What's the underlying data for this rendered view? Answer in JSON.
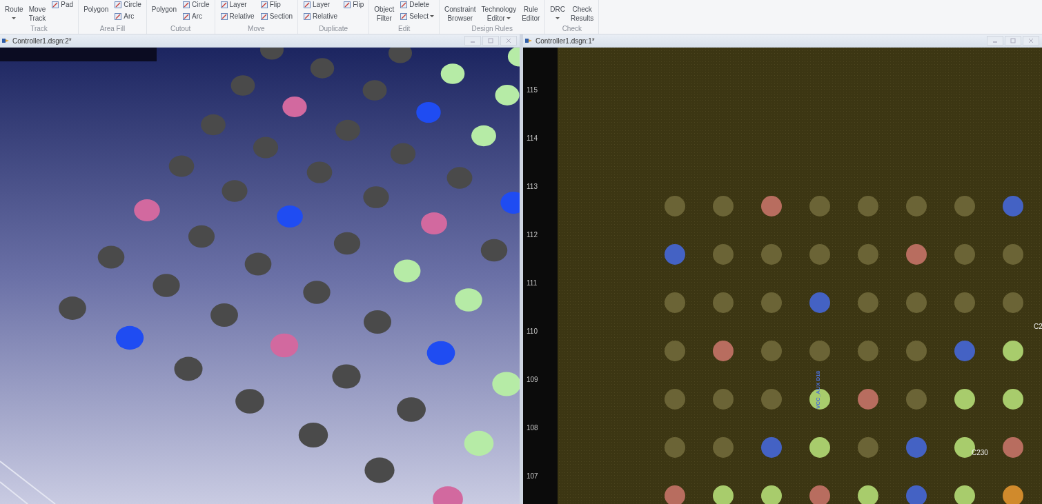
{
  "ribbon": {
    "groups": [
      {
        "label": "Track",
        "items": [
          {
            "kind": "large",
            "lines": [
              "Route"
            ],
            "dropdown": true
          },
          {
            "kind": "large",
            "lines": [
              "Move",
              "Track"
            ],
            "dropdown": false
          },
          {
            "kind": "stack",
            "buttons": [
              {
                "label": "Pad",
                "dropdown": false
              }
            ]
          }
        ]
      },
      {
        "label": "Area Fill",
        "items": [
          {
            "kind": "large",
            "lines": [
              "Polygon"
            ],
            "dropdown": false
          },
          {
            "kind": "stack",
            "buttons": [
              {
                "label": "Circle",
                "dropdown": false
              },
              {
                "label": "Arc",
                "dropdown": false
              }
            ]
          }
        ]
      },
      {
        "label": "Cutout",
        "items": [
          {
            "kind": "large",
            "lines": [
              "Polygon"
            ],
            "dropdown": false
          },
          {
            "kind": "stack",
            "buttons": [
              {
                "label": "Circle",
                "dropdown": false
              },
              {
                "label": "Arc",
                "dropdown": false
              }
            ]
          }
        ]
      },
      {
        "label": "Move",
        "items": [
          {
            "kind": "stack",
            "buttons": [
              {
                "label": "Layer",
                "dropdown": false
              },
              {
                "label": "Relative",
                "dropdown": false
              }
            ]
          },
          {
            "kind": "stack",
            "buttons": [
              {
                "label": "Flip",
                "dropdown": false
              },
              {
                "label": "Section",
                "dropdown": false
              }
            ]
          }
        ]
      },
      {
        "label": "Duplicate",
        "items": [
          {
            "kind": "stack",
            "buttons": [
              {
                "label": "Layer",
                "dropdown": false
              },
              {
                "label": "Relative",
                "dropdown": false
              }
            ]
          },
          {
            "kind": "stack",
            "buttons": [
              {
                "label": "Flip",
                "dropdown": false
              }
            ]
          }
        ]
      },
      {
        "label": "Edit",
        "items": [
          {
            "kind": "large",
            "lines": [
              "Object",
              "Filter"
            ],
            "dropdown": false
          },
          {
            "kind": "stack",
            "buttons": [
              {
                "label": "Delete",
                "dropdown": false
              },
              {
                "label": "Select",
                "dropdown": true
              }
            ]
          }
        ]
      },
      {
        "label": "Design Rules",
        "items": [
          {
            "kind": "large",
            "lines": [
              "Constraint",
              "Browser"
            ],
            "dropdown": false
          },
          {
            "kind": "large",
            "lines": [
              "Technology",
              "Editor"
            ],
            "dropdown": true
          },
          {
            "kind": "large",
            "lines": [
              "Rule",
              "Editor"
            ],
            "dropdown": false
          }
        ]
      },
      {
        "label": "Check",
        "items": [
          {
            "kind": "large",
            "lines": [
              "DRC"
            ],
            "dropdown": true
          },
          {
            "kind": "large",
            "lines": [
              "Check",
              "Results"
            ],
            "dropdown": false
          }
        ]
      }
    ]
  },
  "panes": [
    {
      "title": "Controller1.dsgn:2*",
      "kind": "perspective"
    },
    {
      "title": "Controller1.dsgn:1*",
      "kind": "layout",
      "ruler_labels": [
        "115",
        "114",
        "113",
        "112",
        "111",
        "110",
        "109",
        "108",
        "107"
      ],
      "pad_rows": [
        [
          {
            "color": "#6b6436"
          },
          {
            "color": "#6b6436"
          },
          {
            "color": "#b86d5f"
          },
          {
            "color": "#6b6436"
          },
          {
            "color": "#6b6436"
          },
          {
            "color": "#6b6436"
          },
          {
            "color": "#6b6436"
          },
          {
            "color": "#4462c4"
          }
        ],
        [
          {
            "color": "#4462c4"
          },
          {
            "color": "#6b6436"
          },
          {
            "color": "#6b6436"
          },
          {
            "color": "#6b6436"
          },
          {
            "color": "#6b6436"
          },
          {
            "color": "#b86d5f"
          },
          {
            "color": "#6b6436"
          },
          {
            "color": "#6b6436"
          }
        ],
        [
          {
            "color": "#6b6436"
          },
          {
            "color": "#6b6436"
          },
          {
            "color": "#6b6436"
          },
          {
            "color": "#4462c4"
          },
          {
            "color": "#6b6436"
          },
          {
            "color": "#6b6436"
          },
          {
            "color": "#6b6436"
          },
          {
            "color": "#6b6436"
          }
        ],
        [
          {
            "color": "#6b6436"
          },
          {
            "color": "#b86d5f"
          },
          {
            "color": "#6b6436"
          },
          {
            "color": "#6b6436"
          },
          {
            "color": "#6b6436"
          },
          {
            "color": "#6b6436"
          },
          {
            "color": "#4462c4"
          },
          {
            "color": "#a8cc6c",
            "label": {
              "text": "C2",
              "kind": "offset"
            }
          }
        ],
        [
          {
            "color": "#6b6436"
          },
          {
            "color": "#6b6436"
          },
          {
            "color": "#6b6436"
          },
          {
            "color": "#a8cc6c",
            "label": {
              "text": "VCC_AUX D18",
              "kind": "pin"
            }
          },
          {
            "color": "#b86d5f"
          },
          {
            "color": "#6b6436"
          },
          {
            "color": "#a8cc6c"
          },
          {
            "color": "#a8cc6c"
          }
        ],
        [
          {
            "color": "#6b6436"
          },
          {
            "color": "#6b6436"
          },
          {
            "color": "#4462c4"
          },
          {
            "color": "#a8cc6c"
          },
          {
            "color": "#6b6436"
          },
          {
            "color": "#4462c4"
          },
          {
            "color": "#a8cc6c",
            "label": {
              "text": "C230",
              "kind": "refdes"
            }
          },
          {
            "color": "#b86d5f"
          }
        ],
        [
          {
            "color": "#b86d5f"
          },
          {
            "color": "#a8cc6c"
          },
          {
            "color": "#a8cc6c"
          },
          {
            "color": "#b86d5f"
          },
          {
            "color": "#a8cc6c"
          },
          {
            "color": "#4462c4"
          },
          {
            "color": "#a8cc6c"
          },
          {
            "color": "#d08a2c"
          }
        ]
      ]
    }
  ]
}
